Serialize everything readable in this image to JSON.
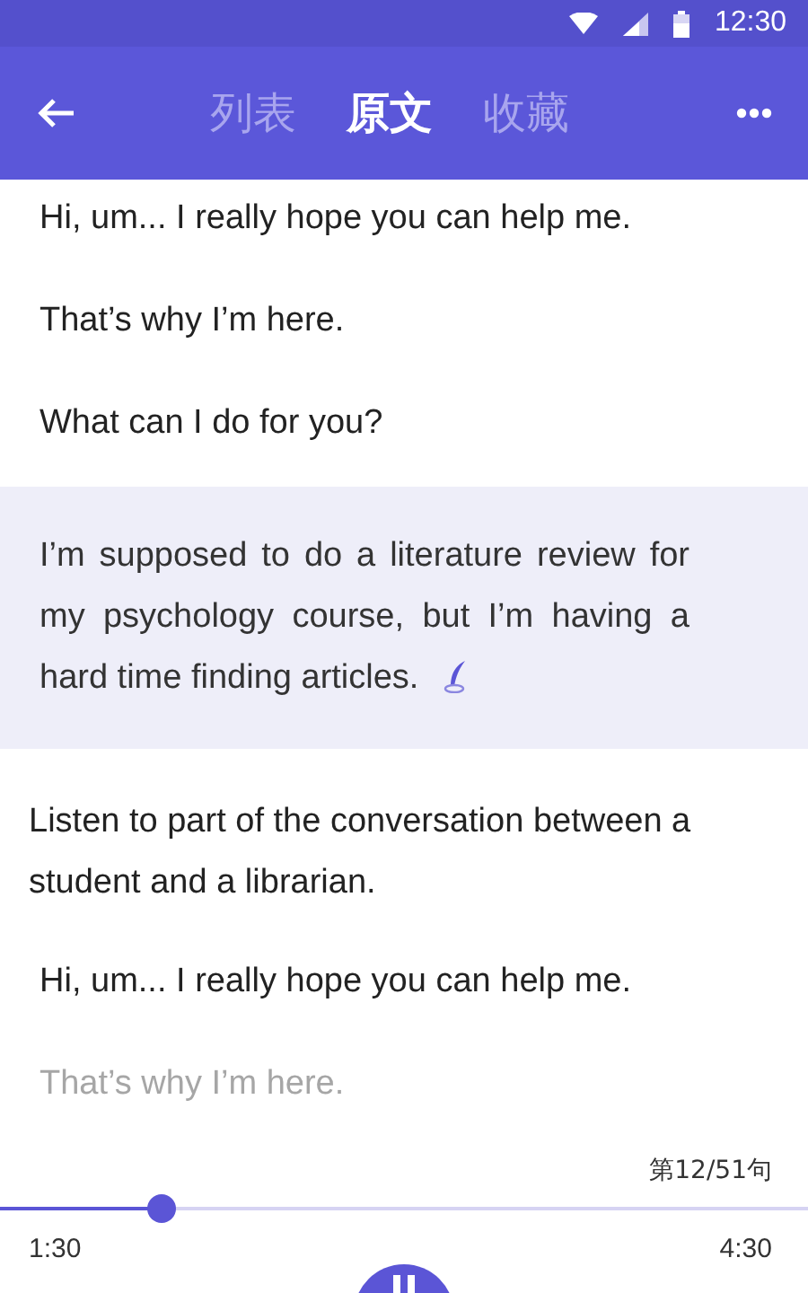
{
  "status_bar": {
    "time": "12:30"
  },
  "tabs": [
    {
      "label": "列表",
      "selected": false
    },
    {
      "label": "原文",
      "selected": true
    },
    {
      "label": "收藏",
      "selected": false
    }
  ],
  "sentences": [
    {
      "kind": "line",
      "text": "Hi, um... I really hope you can help me.",
      "selected": false,
      "dimmed": false
    },
    {
      "kind": "line",
      "text": "That’s why I’m here.",
      "selected": false,
      "dimmed": false
    },
    {
      "kind": "line",
      "text": "What can I do for you?",
      "selected": false,
      "dimmed": false
    },
    {
      "kind": "line",
      "text": "I’m supposed to do a literature review for my psychology course, but I’m having a hard time finding articles.",
      "selected": true,
      "dimmed": false
    },
    {
      "kind": "instruction",
      "text": "Listen to part of the conversation between a student and a librarian.",
      "selected": false,
      "dimmed": false
    },
    {
      "kind": "line",
      "text": "Hi, um... I really hope you can help me.",
      "selected": false,
      "dimmed": false
    },
    {
      "kind": "line",
      "text": "That’s why I’m here.",
      "selected": false,
      "dimmed": true
    }
  ],
  "player": {
    "counter": "第12/51句",
    "level": 0.2,
    "elapsed": "1:30",
    "total": "4:30"
  }
}
